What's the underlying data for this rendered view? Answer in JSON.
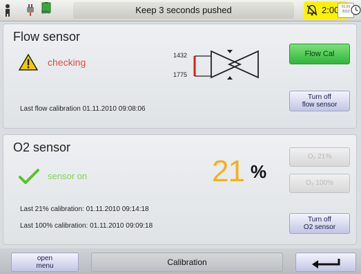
{
  "topbar": {
    "message": "Keep 3 seconds pushed",
    "battery_label": "99%",
    "alarm_time": "2:00",
    "calendar_line1": "01.01",
    "calendar_line2": "2010"
  },
  "flow_sensor": {
    "title": "Flow sensor",
    "status": "checking",
    "flow_value_top": "1432",
    "flow_value_bottom": "1775",
    "flow_cal_label": "Flow Cal",
    "turn_off_line1": "Turn off",
    "turn_off_line2": "flow sensor",
    "last_calibration": "Last flow calibration 01.11.2010 09:08:06"
  },
  "o2_sensor": {
    "title": "O2 sensor",
    "status": "sensor on",
    "value": "21",
    "unit": "%",
    "o2_21_label": "O₂ 21%",
    "o2_100_label": "O₂ 100%",
    "turn_off_line1": "Turn off",
    "turn_off_line2": "O2 sensor",
    "last_21": "Last 21% calibration: 01.11.2010 09:14:18",
    "last_100": "Last 100% calibration: 01.11.2010 09:09:18"
  },
  "bottombar": {
    "open_menu_line1": "open",
    "open_menu_line2": "menu",
    "title": "Calibration"
  },
  "colors": {
    "accent_green": "#30b63a",
    "warning_red": "#e84a3b",
    "sensor_on_green": "#7fd34a",
    "o2_value_orange": "#f5b01c",
    "alarm_yellow": "#fff200"
  },
  "icons": [
    "person-icon",
    "plug-icon",
    "battery-icon",
    "alarm-bell-icon",
    "calendar-icon",
    "clock-icon",
    "warning-icon",
    "check-icon",
    "valve-icon",
    "back-arrow-icon"
  ]
}
